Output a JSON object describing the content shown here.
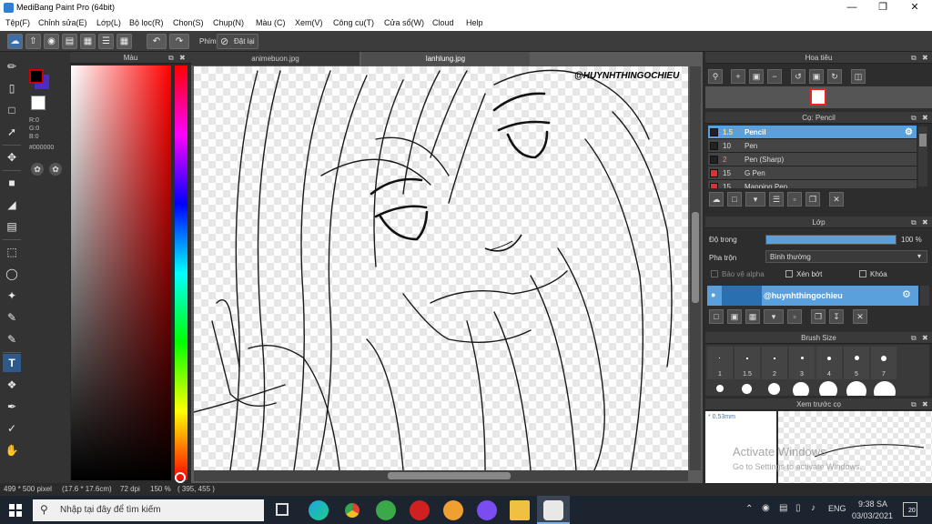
{
  "window": {
    "title": "MediBang Paint Pro (64bit)"
  },
  "menu": [
    "Tệp(F)",
    "Chỉnh sửa(E)",
    "Lớp(L)",
    "Bộ lọc(R)",
    "Chọn(S)",
    "Chụp(N)",
    "Màu (C)",
    "Xem(V)",
    "Công cụ(T)",
    "Cửa sổ(W)",
    "Cloud",
    "Help"
  ],
  "toolbar": {
    "phim_label": "Phím",
    "reset_label": "Đặt lại"
  },
  "color_panel": {
    "title": "Màu",
    "r": "R:0",
    "g": "G:0",
    "b": "B:0",
    "hex": "#000000"
  },
  "canvas": {
    "tabs": [
      "animebuon.jpg",
      "lanhlung.jpg"
    ],
    "watermark": "@HUYNHTHINGOCHIEU"
  },
  "navigator": {
    "title": "Hoa tiêu"
  },
  "brush": {
    "title": "Cọ: Pencil",
    "items": [
      {
        "size": "1.5",
        "name": "Pencil",
        "color": "#222222"
      },
      {
        "size": "10",
        "name": "Pen",
        "color": "#222222"
      },
      {
        "size": "2",
        "name": "Pen (Sharp)",
        "color": "#222222"
      },
      {
        "size": "15",
        "name": "G Pen",
        "color": "#e03030"
      },
      {
        "size": "15",
        "name": "Mapping Pen",
        "color": "#e03030"
      }
    ]
  },
  "layer": {
    "title": "Lớp",
    "opacity_label": "Độ trong",
    "opacity_value": "100 %",
    "blend_label": "Pha trộn",
    "blend_value": "Bình thường",
    "protect_alpha": "Bảo vệ alpha",
    "clipping": "Xén bớt",
    "lock": "Khóa",
    "layer_name": "@huynhthingochieu"
  },
  "brush_size": {
    "title": "Brush Size",
    "sizes": [
      "1",
      "1.5",
      "2",
      "3",
      "4",
      "5",
      "7"
    ]
  },
  "brush_preview": {
    "title": "Xem trước cọ",
    "size": "* 0.53mm",
    "activate_1": "Activate Windows",
    "activate_2": "Go to Settings to activate Windows."
  },
  "status": {
    "dims": "499 * 500 pixel",
    "cm": "(17.6 * 17.6cm)",
    "dpi": "72 dpi",
    "zoom": "150 %",
    "coords": "( 395, 455 )"
  },
  "taskbar": {
    "search_placeholder": "Nhập tại đây để tìm kiếm",
    "lang": "ENG",
    "time": "9:38 SA",
    "date": "03/03/2021",
    "notif_count": "20"
  }
}
